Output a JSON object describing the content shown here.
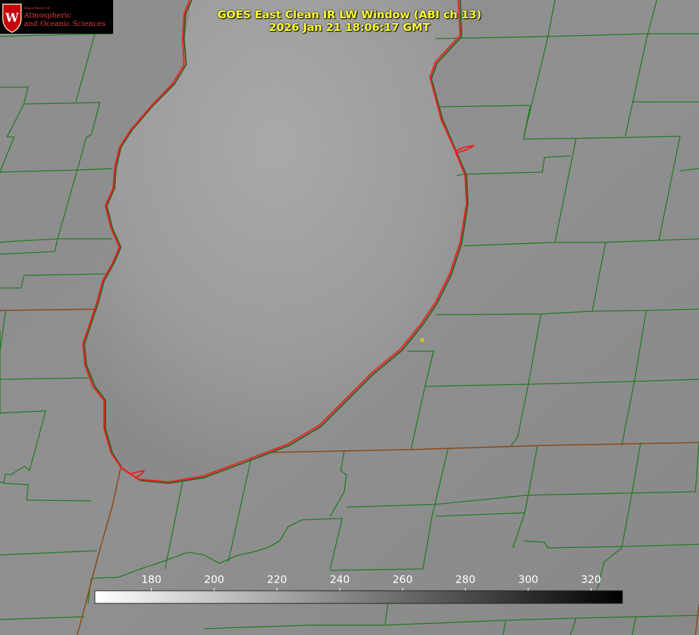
{
  "header": {
    "title_line1": "GOES East Clean IR LW Window (ABI ch 13)",
    "title_line2": "2026 Jan 21 18:06:17 GMT"
  },
  "logo": {
    "department": "Department of",
    "line1": "Atmospheric",
    "line2": "and Oceanic Sciences",
    "seal_letter": "W"
  },
  "colorbar": {
    "ticks": [
      "180",
      "200",
      "220",
      "240",
      "260",
      "280",
      "300",
      "320"
    ],
    "min": 162,
    "max": 330,
    "gradient": [
      "#ffffff",
      "#000000"
    ]
  },
  "colors": {
    "county_lines": "#1f7a1f",
    "lake_shoreline": "#ee2222",
    "state_lines": "#8a4a1a",
    "title_text": "#ffff33",
    "marker": "#d4c21a"
  }
}
